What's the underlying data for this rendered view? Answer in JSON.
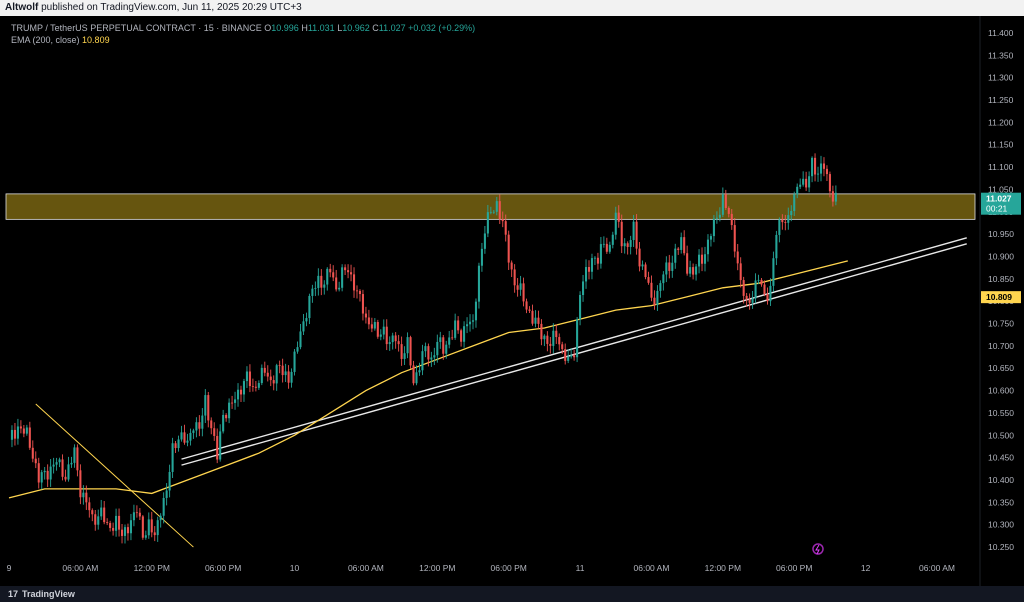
{
  "header": {
    "author": "Altwolf",
    "published_text": "published on TradingView.com, Jun 11, 2025 20:29 UTC+3"
  },
  "legend": {
    "symbol": "TRUMP / TetherUS PERPETUAL CONTRACT · 15 · BINANCE",
    "o_label": "O",
    "o_value": "10.996",
    "h_label": "H",
    "h_value": "11.031",
    "l_label": "L",
    "l_value": "10.962",
    "c_label": "C",
    "c_value": "11.027",
    "change": "+0.032 (+0.29%)",
    "ema_label": "EMA (200, close)",
    "ema_value": "10.809"
  },
  "price_tag": {
    "price": "11.027",
    "countdown": "00:21"
  },
  "ema_tag": "10.809",
  "footer": {
    "brand": "TradingView",
    "logo_text": "17"
  },
  "colors": {
    "up": "#26a69a",
    "down": "#ef5350",
    "ema": "#ffd54f",
    "zone_fill": "#6b5a10",
    "price_tag": "#26a69a",
    "ema_tag": "#ffd54f"
  },
  "chart_data": {
    "type": "candlestick",
    "y_ticks": [
      "11.400",
      "11.350",
      "11.300",
      "11.250",
      "11.200",
      "11.150",
      "11.100",
      "11.050",
      "11.000",
      "10.950",
      "10.900",
      "10.850",
      "10.800",
      "10.750",
      "10.700",
      "10.650",
      "10.600",
      "10.550",
      "10.500",
      "10.450",
      "10.400",
      "10.350",
      "10.300",
      "10.250"
    ],
    "ylim": [
      10.23,
      11.42
    ],
    "x_ticks": [
      {
        "label": "9",
        "t": 0
      },
      {
        "label": "06:00 AM",
        "t": 24
      },
      {
        "label": "12:00 PM",
        "t": 48
      },
      {
        "label": "06:00 PM",
        "t": 72
      },
      {
        "label": "10",
        "t": 96
      },
      {
        "label": "06:00 AM",
        "t": 120
      },
      {
        "label": "12:00 PM",
        "t": 144
      },
      {
        "label": "06:00 PM",
        "t": 168
      },
      {
        "label": "11",
        "t": 192
      },
      {
        "label": "06:00 AM",
        "t": 216
      },
      {
        "label": "12:00 PM",
        "t": 240
      },
      {
        "label": "06:00 PM",
        "t": 264
      },
      {
        "label": "12",
        "t": 288
      },
      {
        "label": "06:00 AM",
        "t": 312
      }
    ],
    "close_path": [
      [
        0,
        10.49
      ],
      [
        3,
        10.52
      ],
      [
        6,
        10.5
      ],
      [
        8,
        10.46
      ],
      [
        10,
        10.4
      ],
      [
        13,
        10.42
      ],
      [
        16,
        10.44
      ],
      [
        19,
        10.41
      ],
      [
        22,
        10.46
      ],
      [
        24,
        10.38
      ],
      [
        26,
        10.35
      ],
      [
        28,
        10.31
      ],
      [
        31,
        10.33
      ],
      [
        33,
        10.29
      ],
      [
        36,
        10.31
      ],
      [
        38,
        10.27
      ],
      [
        40,
        10.3
      ],
      [
        43,
        10.33
      ],
      [
        45,
        10.28
      ],
      [
        47,
        10.3
      ],
      [
        49,
        10.27
      ],
      [
        51,
        10.34
      ],
      [
        53,
        10.37
      ],
      [
        55,
        10.47
      ],
      [
        57,
        10.5
      ],
      [
        60,
        10.48
      ],
      [
        62,
        10.53
      ],
      [
        64,
        10.51
      ],
      [
        66,
        10.58
      ],
      [
        68,
        10.52
      ],
      [
        70,
        10.45
      ],
      [
        72,
        10.55
      ],
      [
        74,
        10.56
      ],
      [
        76,
        10.58
      ],
      [
        78,
        10.61
      ],
      [
        80,
        10.63
      ],
      [
        82,
        10.6
      ],
      [
        84,
        10.63
      ],
      [
        86,
        10.64
      ],
      [
        88,
        10.62
      ],
      [
        90,
        10.65
      ],
      [
        92,
        10.64
      ],
      [
        94,
        10.63
      ],
      [
        96,
        10.67
      ],
      [
        98,
        10.73
      ],
      [
        100,
        10.78
      ],
      [
        102,
        10.82
      ],
      [
        104,
        10.85
      ],
      [
        106,
        10.84
      ],
      [
        108,
        10.87
      ],
      [
        110,
        10.83
      ],
      [
        112,
        10.86
      ],
      [
        114,
        10.87
      ],
      [
        116,
        10.84
      ],
      [
        118,
        10.8
      ],
      [
        120,
        10.76
      ],
      [
        122,
        10.75
      ],
      [
        124,
        10.72
      ],
      [
        126,
        10.74
      ],
      [
        128,
        10.7
      ],
      [
        130,
        10.72
      ],
      [
        132,
        10.68
      ],
      [
        134,
        10.7
      ],
      [
        136,
        10.62
      ],
      [
        138,
        10.66
      ],
      [
        140,
        10.69
      ],
      [
        142,
        10.67
      ],
      [
        144,
        10.71
      ],
      [
        146,
        10.69
      ],
      [
        148,
        10.72
      ],
      [
        150,
        10.74
      ],
      [
        152,
        10.72
      ],
      [
        154,
        10.76
      ],
      [
        156,
        10.74
      ],
      [
        158,
        10.88
      ],
      [
        160,
        10.96
      ],
      [
        162,
        11.0
      ],
      [
        164,
        11.02
      ],
      [
        166,
        10.97
      ],
      [
        168,
        10.9
      ],
      [
        170,
        10.84
      ],
      [
        172,
        10.82
      ],
      [
        174,
        10.79
      ],
      [
        176,
        10.76
      ],
      [
        178,
        10.74
      ],
      [
        180,
        10.72
      ],
      [
        182,
        10.7
      ],
      [
        184,
        10.73
      ],
      [
        186,
        10.69
      ],
      [
        188,
        10.66
      ],
      [
        190,
        10.69
      ],
      [
        192,
        10.82
      ],
      [
        194,
        10.86
      ],
      [
        196,
        10.9
      ],
      [
        198,
        10.89
      ],
      [
        200,
        10.93
      ],
      [
        202,
        10.92
      ],
      [
        204,
        10.99
      ],
      [
        206,
        10.94
      ],
      [
        208,
        10.92
      ],
      [
        210,
        10.96
      ],
      [
        212,
        10.89
      ],
      [
        214,
        10.86
      ],
      [
        216,
        10.8
      ],
      [
        218,
        10.82
      ],
      [
        220,
        10.86
      ],
      [
        222,
        10.88
      ],
      [
        224,
        10.91
      ],
      [
        226,
        10.93
      ],
      [
        228,
        10.88
      ],
      [
        230,
        10.86
      ],
      [
        232,
        10.89
      ],
      [
        234,
        10.91
      ],
      [
        236,
        10.95
      ],
      [
        238,
        10.99
      ],
      [
        240,
        11.03
      ],
      [
        242,
        10.99
      ],
      [
        244,
        10.93
      ],
      [
        246,
        10.84
      ],
      [
        248,
        10.79
      ],
      [
        250,
        10.82
      ],
      [
        252,
        10.85
      ],
      [
        254,
        10.81
      ],
      [
        256,
        10.83
      ],
      [
        258,
        10.95
      ],
      [
        260,
        10.99
      ],
      [
        262,
        10.98
      ],
      [
        264,
        11.03
      ],
      [
        266,
        11.08
      ],
      [
        268,
        11.05
      ],
      [
        270,
        11.11
      ],
      [
        272,
        11.09
      ],
      [
        274,
        11.1
      ],
      [
        276,
        11.05
      ],
      [
        278,
        11.03
      ]
    ],
    "ema200": [
      [
        0,
        10.36
      ],
      [
        12,
        10.38
      ],
      [
        24,
        10.38
      ],
      [
        36,
        10.38
      ],
      [
        48,
        10.37
      ],
      [
        60,
        10.4
      ],
      [
        72,
        10.43
      ],
      [
        84,
        10.46
      ],
      [
        96,
        10.5
      ],
      [
        108,
        10.55
      ],
      [
        120,
        10.6
      ],
      [
        132,
        10.64
      ],
      [
        144,
        10.67
      ],
      [
        156,
        10.7
      ],
      [
        168,
        10.73
      ],
      [
        180,
        10.74
      ],
      [
        192,
        10.76
      ],
      [
        204,
        10.78
      ],
      [
        216,
        10.79
      ],
      [
        228,
        10.81
      ],
      [
        240,
        10.83
      ],
      [
        252,
        10.84
      ],
      [
        264,
        10.86
      ],
      [
        276,
        10.88
      ],
      [
        282,
        10.89
      ]
    ],
    "resistance_zone": [
      10.983,
      11.04
    ],
    "trendline_support": [
      [
        58,
        10.44
      ],
      [
        322,
        10.935
      ]
    ],
    "trendline_down": [
      [
        9,
        10.57
      ],
      [
        62,
        10.25
      ]
    ],
    "last_price": 11.027,
    "ema_last": 10.809
  }
}
